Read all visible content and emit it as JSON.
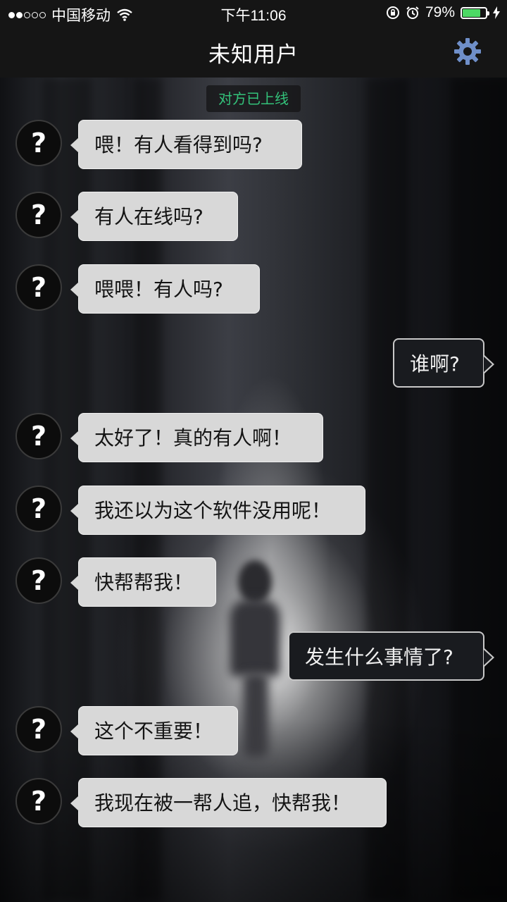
{
  "status_bar": {
    "carrier": "中国移动",
    "time": "下午11:06",
    "battery_percent": "79%",
    "battery_level": 0.79,
    "icons": [
      "signal-dots-icon",
      "wifi-icon",
      "orientation-lock-icon",
      "alarm-icon",
      "battery-icon",
      "charging-icon"
    ]
  },
  "header": {
    "title": "未知用户",
    "settings_icon": "gear-icon",
    "accent_color": "#6f8fc9"
  },
  "chat": {
    "online_notice": "对方已上线",
    "avatar_symbol": "?",
    "messages": [
      {
        "from": "other",
        "text": "喂！有人看得到吗?"
      },
      {
        "from": "other",
        "text": "有人在线吗?"
      },
      {
        "from": "other",
        "text": "喂喂！有人吗?"
      },
      {
        "from": "me",
        "text": "谁啊?"
      },
      {
        "from": "other",
        "text": "太好了！真的有人啊！"
      },
      {
        "from": "other",
        "text": "我还以为这个软件没用呢！"
      },
      {
        "from": "other",
        "text": "快帮帮我！"
      },
      {
        "from": "me",
        "text": "发生什么事情了?"
      },
      {
        "from": "other",
        "text": "这个不重要！"
      },
      {
        "from": "other",
        "text": "我现在被一帮人追，快帮我！"
      }
    ]
  }
}
